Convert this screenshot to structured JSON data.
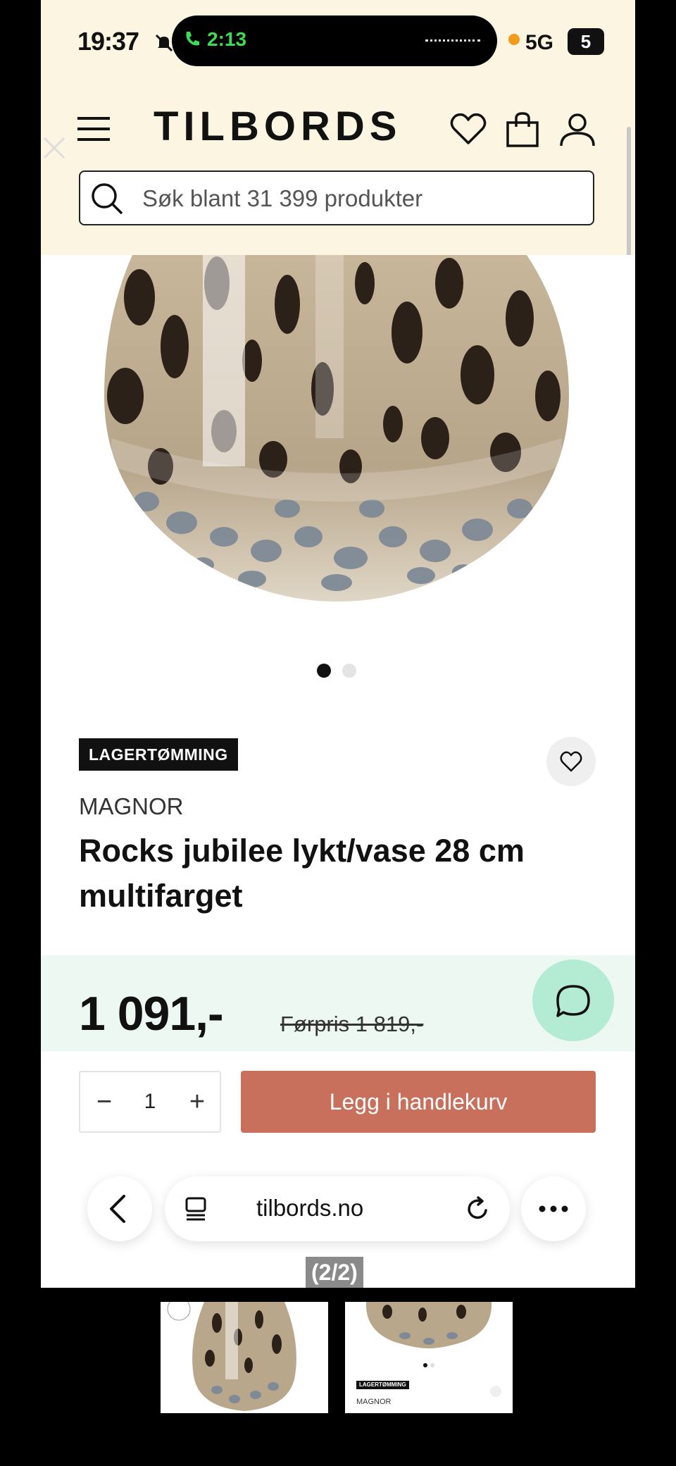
{
  "status_bar": {
    "time": "19:37",
    "call_time": "2:13",
    "network": "5G",
    "battery": "5"
  },
  "header": {
    "logo": "TILBORDS",
    "search_placeholder": "Søk blant 31 399 produkter"
  },
  "carousel": {
    "total_slides": 2,
    "active_slide": 1
  },
  "product": {
    "badge": "LAGERTØMMING",
    "brand": "MAGNOR",
    "title": "Rocks jubilee lykt/vase 28 cm multifarget",
    "price": "1 091,-",
    "former_price": "Førpris 1 819,-"
  },
  "cart": {
    "quantity": "1",
    "minus_label": "−",
    "plus_label": "+",
    "add_label": "Legg i handlekurv"
  },
  "browser": {
    "url": "tilbords.no"
  },
  "viewer": {
    "page_counter": "(2/2)",
    "thumb_badge": "LAGERTØMMING",
    "thumb_brand": "MAGNOR"
  },
  "colors": {
    "header_bg": "#fbf5e2",
    "cta": "#c9705c",
    "price_band": "#eef8f3",
    "chat": "#b3ecd3",
    "call_green": "#3ddc57"
  },
  "icons": [
    "mute-icon",
    "call-icon",
    "close-icon",
    "menu-icon",
    "heart-icon",
    "shopping-bag-icon",
    "user-icon",
    "search-icon",
    "chat-icon",
    "chevron-left-icon",
    "tabs-icon",
    "reload-icon",
    "more-icon"
  ]
}
